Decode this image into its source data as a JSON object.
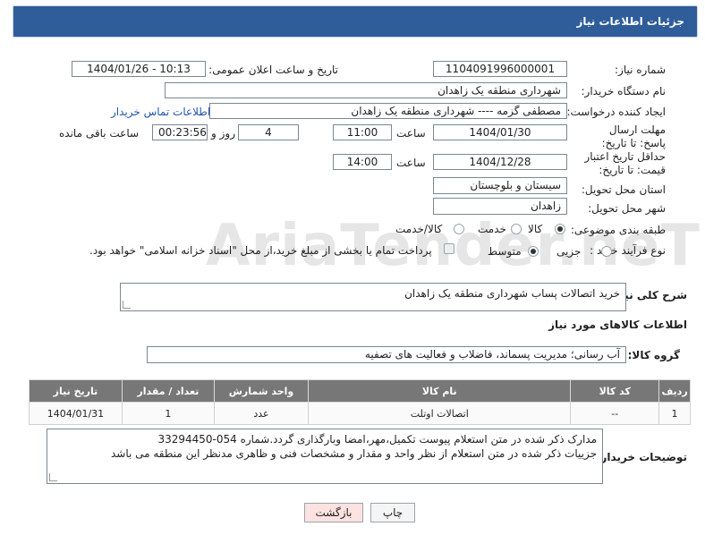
{
  "header": {
    "title": "جزئیات اطلاعات نیاز"
  },
  "form": {
    "need_number_label": "شماره نیاز:",
    "need_number": "1104091996000001",
    "public_announce_label": "تاریخ و ساعت اعلان عمومی:",
    "public_announce_value": "1404/01/26 - 10:13",
    "buyer_org_label": "نام دستگاه خریدار:",
    "buyer_org": "شهرداری منطقه یک زاهدان",
    "requester_label": "ایجاد کننده درخواست:",
    "requester": "مصطفی گزمه ---- شهرداری منطقه یک زاهدان",
    "buyer_contact_link": "اطلاعات تماس خریدار",
    "reply_deadline_label": "مهلت ارسال پاسخ: تا تاریخ:",
    "reply_date": "1404/01/30",
    "time_label": "ساعت",
    "reply_time": "11:00",
    "days_value": "4",
    "days_and_label": "روز و",
    "remaining_time": "00:23:56",
    "remaining_label": "ساعت باقی مانده",
    "price_validity_label": "حداقل تاریخ اعتبار قیمت: تا تاریخ:",
    "price_validity_date": "1404/12/28",
    "price_validity_time": "14:00",
    "province_label": "استان محل تحویل:",
    "province": "سیستان و بلوچستان",
    "city_label": "شهر محل تحویل:",
    "city": "زاهدان",
    "category_label": "طبقه بندی موضوعی:",
    "category_options": [
      "کالا",
      "خدمت",
      "کالا/خدمت"
    ],
    "category_selected": "کالا",
    "purchase_type_label": "نوع فرآیند خرید :",
    "purchase_type_options": [
      "جزیی",
      "متوسط"
    ],
    "purchase_type_selected": "متوسط",
    "payment_note": "پرداخت تمام یا بخشی از مبلغ خرید،از محل \"اسناد خزانه اسلامی\" خواهد بود."
  },
  "description": {
    "label": "شرح کلی نیاز:",
    "value": "خرید اتصالات پساب شهرداری منطقه یک زاهدان"
  },
  "goods_section": {
    "title": "اطلاعات کالاهای مورد نیاز",
    "group_label": "گروه کالا:",
    "group_value": "آب رسانی؛ مدیریت پسماند، فاضلاب و فعالیت های تصفیه"
  },
  "table": {
    "headers": [
      "ردیف",
      "کد کالا",
      "نام کالا",
      "واحد شمارش",
      "تعداد / مقدار",
      "تاریخ نیاز"
    ],
    "rows": [
      {
        "row": "1",
        "code": "--",
        "name": "اتصالات اوتلت",
        "unit": "عدد",
        "qty": "1",
        "date": "1404/01/31"
      }
    ]
  },
  "buyer_notes": {
    "label": "توضیحات خریدار:",
    "line1": "مدارک ذکر شده در متن استعلام پیوست تکمیل،مهر،امضا وبارگذاری گردد.شماره 054-33294450",
    "line2": "جزییات ذکر شده در متن استعلام از نظر واحد و مقدار و مشخصات فنی و ظاهری مدنظر این منطقه می باشد"
  },
  "buttons": {
    "print": "چاپ",
    "back": "بازگشت"
  },
  "watermark": "AriaTender.neT",
  "colors": {
    "header_bg": "#2f5d9a",
    "table_header_bg": "#777777",
    "link": "#1f56b0",
    "back_btn_bg": "#fde2e2"
  }
}
